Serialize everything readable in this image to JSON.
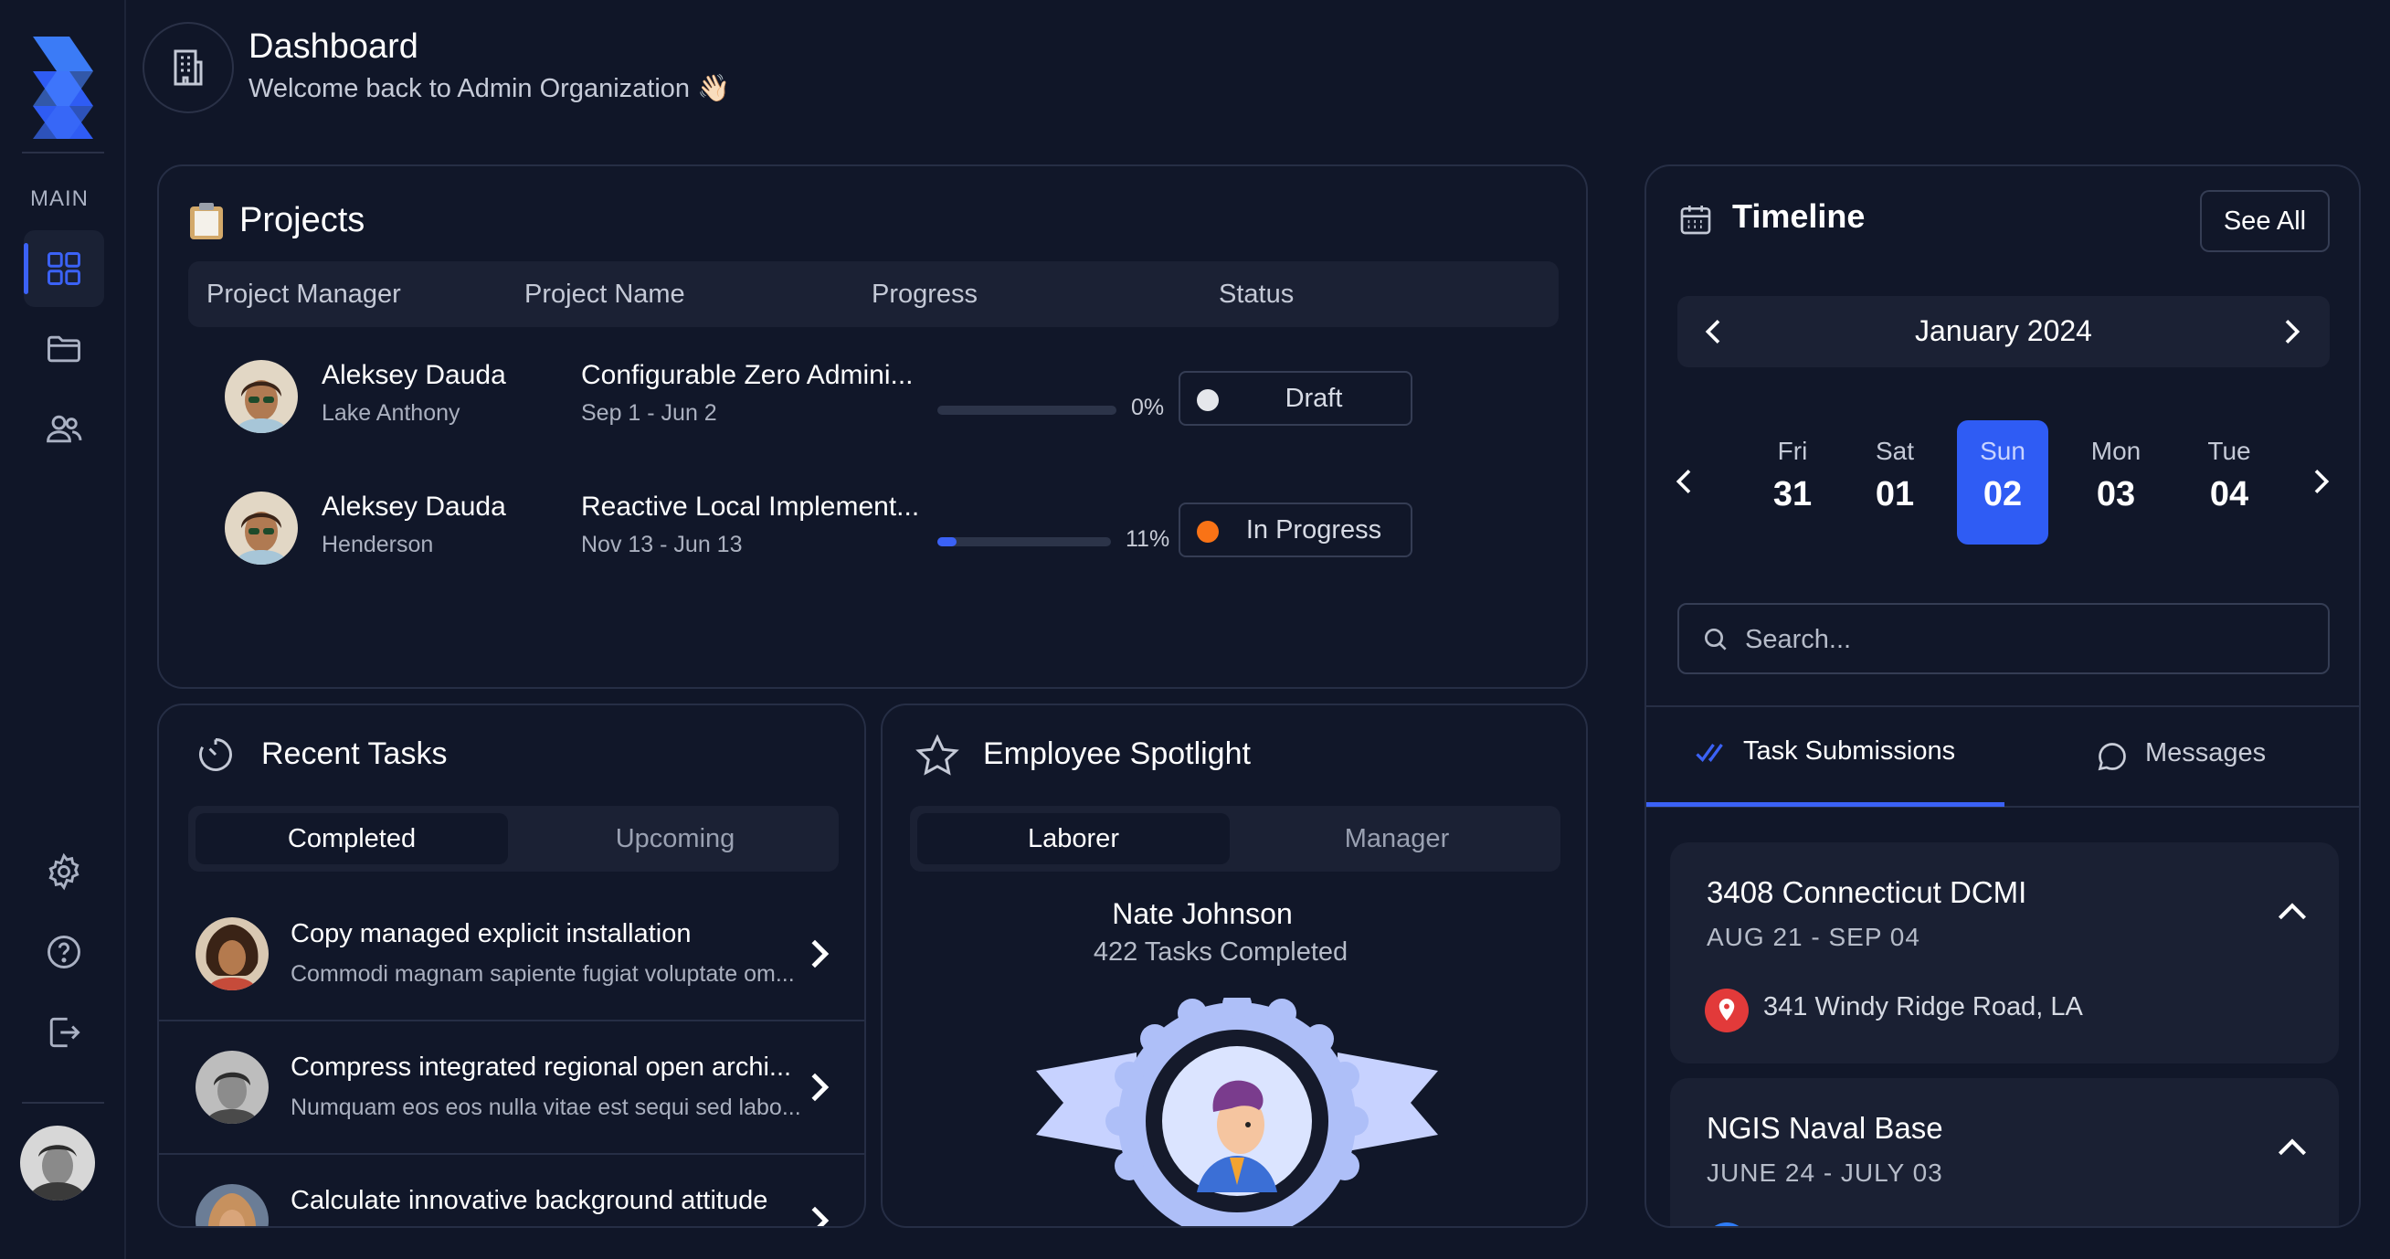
{
  "sidebar": {
    "section_label": "MAIN",
    "items": [
      {
        "name": "dashboard",
        "icon": "grid-icon",
        "active": true
      },
      {
        "name": "projects",
        "icon": "folder-icon"
      },
      {
        "name": "team",
        "icon": "users-icon"
      }
    ],
    "bottom_items": [
      {
        "name": "settings",
        "icon": "gear-icon"
      },
      {
        "name": "help",
        "icon": "help-circle-icon"
      },
      {
        "name": "logout",
        "icon": "logout-icon"
      }
    ]
  },
  "header": {
    "title": "Dashboard",
    "subtitle": "Welcome back to Admin Organization 👋🏻"
  },
  "projects": {
    "title": "Projects",
    "icon": "clipboard-icon",
    "columns": [
      "Project Manager",
      "Project Name",
      "Progress",
      "Status"
    ],
    "rows": [
      {
        "manager": "Aleksey Dauda",
        "location": "Lake Anthony",
        "project": "Configurable Zero Admini...",
        "dates": "Sep 1 - Jun 2",
        "progress": 0,
        "progress_label": "0%",
        "status": "Draft",
        "status_color": "#e5e7eb"
      },
      {
        "manager": "Aleksey Dauda",
        "location": "Henderson",
        "project": "Reactive Local Implement...",
        "dates": "Nov 13 - Jun 13",
        "progress": 11,
        "progress_label": "11%",
        "status": "In Progress",
        "status_color": "#f97316"
      }
    ]
  },
  "recent_tasks": {
    "title": "Recent Tasks",
    "tabs": [
      "Completed",
      "Upcoming"
    ],
    "active_tab": "Completed",
    "items": [
      {
        "title": "Copy managed explicit installation",
        "subtitle": "Commodi magnam sapiente fugiat voluptate om..."
      },
      {
        "title": "Compress integrated regional open archi...",
        "subtitle": "Numquam eos eos nulla vitae est sequi sed labo..."
      },
      {
        "title": "Calculate innovative background attitude",
        "subtitle": ""
      }
    ]
  },
  "spotlight": {
    "title": "Employee Spotlight",
    "tabs": [
      "Laborer",
      "Manager"
    ],
    "active_tab": "Laborer",
    "name": "Nate Johnson",
    "tasks_completed": "422 Tasks Completed"
  },
  "timeline": {
    "title": "Timeline",
    "see_all": "See All",
    "month": "January 2024",
    "days": [
      {
        "dow": "Fri",
        "date": "31"
      },
      {
        "dow": "Sat",
        "date": "01"
      },
      {
        "dow": "Sun",
        "date": "02",
        "active": true
      },
      {
        "dow": "Mon",
        "date": "03"
      },
      {
        "dow": "Tue",
        "date": "04"
      }
    ],
    "search_placeholder": "Search...",
    "tabs": [
      "Task Submissions",
      "Messages"
    ],
    "active_tab": "Task Submissions",
    "submissions": [
      {
        "title": "3408 Connecticut DCMI",
        "dates": "AUG 21 - SEP 04",
        "address": "341 Windy Ridge Road, LA"
      },
      {
        "title": "NGIS Naval Base",
        "dates": "JUNE 24 - JULY 03",
        "address": ""
      }
    ]
  },
  "colors": {
    "background": "#101628",
    "accent": "#3b62f6",
    "in_progress": "#f97316",
    "location_pin": "#e23a3a"
  }
}
